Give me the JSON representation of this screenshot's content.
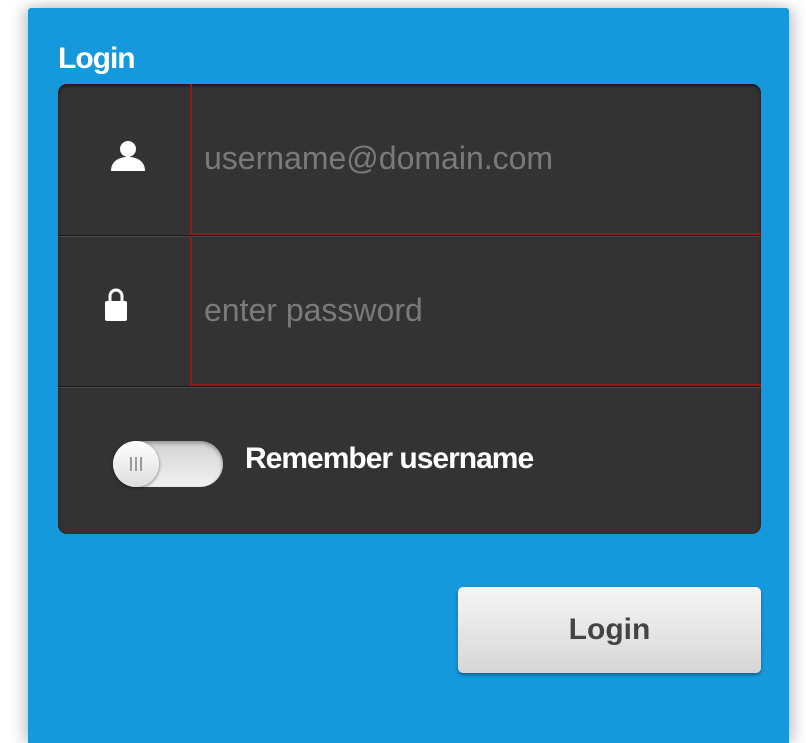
{
  "colors": {
    "panel_background": "#1598dc",
    "form_background": "#333333",
    "input_border": "#8a1c1c",
    "button_text": "#444444"
  },
  "login_panel": {
    "title": "Login",
    "username": {
      "icon": "user-icon",
      "value": "",
      "placeholder": "username@domain.com"
    },
    "password": {
      "icon": "lock-icon",
      "value": "",
      "placeholder": "enter password"
    },
    "remember": {
      "toggle_state": "off",
      "label": "Remember username"
    },
    "login_button_label": "Login"
  }
}
